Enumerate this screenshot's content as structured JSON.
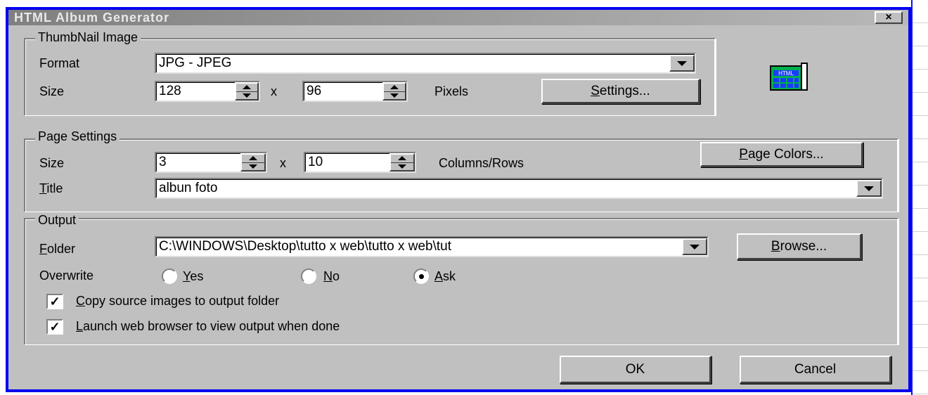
{
  "title": "HTML Album Generator",
  "close_label": "×",
  "thumbnail": {
    "group_label": "ThumbNail Image",
    "format_label": "Format",
    "format_value": "JPG - JPEG",
    "size_label": "Size",
    "width": "128",
    "times": "x",
    "height": "96",
    "unit": "Pixels",
    "settings_prefix": "S",
    "settings_rest": "ettings..."
  },
  "page": {
    "group_label": "Page Settings",
    "size_label": "Size",
    "columns": "3",
    "times": "x",
    "rows": "10",
    "unit": "Columns/Rows",
    "colors_prefix": "P",
    "colors_rest": "age Colors...",
    "title_prefix": "T",
    "title_rest": "itle",
    "title_value": "albun foto"
  },
  "output": {
    "group_label": "Output",
    "folder_prefix": "F",
    "folder_rest": "older",
    "folder_value": "C:\\WINDOWS\\Desktop\\tutto x web\\tutto x web\\tut",
    "browse_prefix": "B",
    "browse_rest": "rowse...",
    "overwrite_label": "Overwrite",
    "options": [
      {
        "prefix": "Y",
        "rest": "es",
        "selected": false
      },
      {
        "prefix": "N",
        "rest": "o",
        "selected": false
      },
      {
        "prefix": "A",
        "rest": "sk",
        "selected": true
      }
    ],
    "copy_prefix": "C",
    "copy_rest": "opy source images to output folder",
    "copy_checked": true,
    "launch_prefix": "L",
    "launch_rest": "aunch web browser to view output when done",
    "launch_checked": true
  },
  "ok_label": "OK",
  "cancel_label": "Cancel",
  "icon": {
    "name": "html-document-icon",
    "text": "HTML"
  },
  "colors": {
    "frame": "#0000f0",
    "dialog": "#c0c0c0",
    "icon_green": "#00b050",
    "icon_blue": "#1a3cff"
  }
}
